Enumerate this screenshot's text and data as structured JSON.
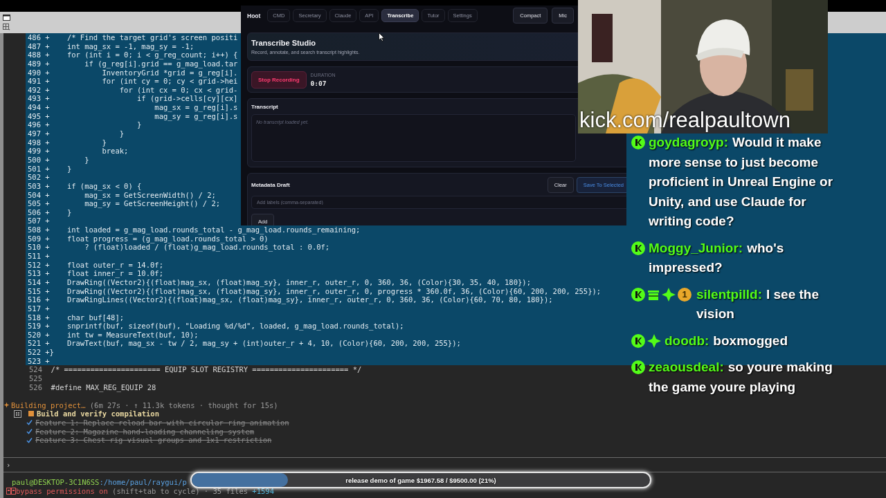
{
  "terminal": {
    "diff_lines": [
      {
        "number": "486",
        "marker": "+",
        "code": "    /* Find the target grid's screen positi"
      },
      {
        "number": "487",
        "marker": "+",
        "code": "    int mag_sx = -1, mag_sy = -1;"
      },
      {
        "number": "488",
        "marker": "+",
        "code": "    for (int i = 0; i < g_reg_count; i++) {"
      },
      {
        "number": "489",
        "marker": "+",
        "code": "        if (g_reg[i].grid == g_mag_load.tar"
      },
      {
        "number": "490",
        "marker": "+",
        "code": "            InventoryGrid *grid = g_reg[i]."
      },
      {
        "number": "491",
        "marker": "+",
        "code": "            for (int cy = 0; cy < grid->hei"
      },
      {
        "number": "492",
        "marker": "+",
        "code": "                for (int cx = 0; cx < grid-"
      },
      {
        "number": "493",
        "marker": "+",
        "code": "                    if (grid->cells[cy][cx]"
      },
      {
        "number": "494",
        "marker": "+",
        "code": "                        mag_sx = g_reg[i].s"
      },
      {
        "number": "495",
        "marker": "+",
        "code": "                        mag_sy = g_reg[i].s"
      },
      {
        "number": "496",
        "marker": "+",
        "code": "                    }"
      },
      {
        "number": "497",
        "marker": "+",
        "code": "                }"
      },
      {
        "number": "498",
        "marker": "+",
        "code": "            }"
      },
      {
        "number": "499",
        "marker": "+",
        "code": "            break;"
      },
      {
        "number": "500",
        "marker": "+",
        "code": "        }"
      },
      {
        "number": "501",
        "marker": "+",
        "code": "    }"
      },
      {
        "number": "502",
        "marker": "+"
      },
      {
        "number": "503",
        "marker": "+",
        "code": "    if (mag_sx < 0) {"
      },
      {
        "number": "504",
        "marker": "+",
        "code": "        mag_sx = GetScreenWidth() / 2;"
      },
      {
        "number": "505",
        "marker": "+",
        "code": "        mag_sy = GetScreenHeight() / 2;"
      },
      {
        "number": "506",
        "marker": "+",
        "code": "    }"
      },
      {
        "number": "507",
        "marker": "+"
      },
      {
        "number": "508",
        "marker": "+",
        "code": "    int loaded = g_mag_load.rounds_total - g_mag_load.rounds_remaining;"
      },
      {
        "number": "509",
        "marker": "+",
        "code": "    float progress = (g_mag_load.rounds_total > 0)"
      },
      {
        "number": "510",
        "marker": "+",
        "code": "        ? (float)loaded / (float)g_mag_load.rounds_total : 0.0f;"
      },
      {
        "number": "511",
        "marker": "+"
      },
      {
        "number": "512",
        "marker": "+",
        "code": "    float outer_r = 14.0f;"
      },
      {
        "number": "513",
        "marker": "+",
        "code": "    float inner_r = 10.0f;"
      },
      {
        "number": "514",
        "marker": "+",
        "code": "    DrawRing((Vector2){(float)mag_sx, (float)mag_sy}, inner_r, outer_r, 0, 360, 36, (Color){30, 35, 40, 180});"
      },
      {
        "number": "515",
        "marker": "+",
        "code": "    DrawRing((Vector2){(float)mag_sx, (float)mag_sy}, inner_r, outer_r, 0, progress * 360.0f, 36, (Color){60, 200, 200, 255});"
      },
      {
        "number": "516",
        "marker": "+",
        "code": "    DrawRingLines((Vector2){(float)mag_sx, (float)mag_sy}, inner_r, outer_r, 0, 360, 36, (Color){60, 70, 80, 180});"
      },
      {
        "number": "517",
        "marker": "+"
      },
      {
        "number": "518",
        "marker": "+",
        "code": "    char buf[48];"
      },
      {
        "number": "519",
        "marker": "+",
        "code": "    snprintf(buf, sizeof(buf), \"Loading %d/%d\", loaded, g_mag_load.rounds_total);"
      },
      {
        "number": "520",
        "marker": "+",
        "code": "    int tw = MeasureText(buf, 10);"
      },
      {
        "number": "521",
        "marker": "+",
        "code": "    DrawText(buf, mag_sx - tw / 2, mag_sy + (int)outer_r + 4, 10, (Color){60, 200, 200, 255});"
      },
      {
        "number": "522",
        "marker": "+",
        "code": "}"
      },
      {
        "number": "523",
        "marker": "+"
      }
    ],
    "context_lines": [
      {
        "number": "524",
        "code": "/* ====================== EQUIP SLOT REGISTRY ====================== */"
      },
      {
        "number": "525"
      },
      {
        "number": "526",
        "code": "#define MAX_REG_EQUIP 28"
      }
    ],
    "status": {
      "label": "Building project…",
      "detail": "(6m 27s · ↑ 11.3k tokens · thought for 15s)"
    },
    "tasks": [
      {
        "text": "Build and verify compilation",
        "done": false
      },
      {
        "text": "Feature 1: Replace reload bar with circular ring animation",
        "done": true
      },
      {
        "text": "Feature 2: Magazine hand-loading channeling system",
        "done": true
      },
      {
        "text": "Feature 3: Chest rig visual groups and 1x1 restriction",
        "done": true
      }
    ],
    "prompt": "›",
    "user_host": "paul@DESKTOP-3C1N6SS",
    "path": ":/home/paul/raygui/p",
    "mode": "bypass permissions on",
    "mode_hint": "(shift+tab to cycle) · 35 files",
    "additions": "+1594"
  },
  "app": {
    "brand": "Hoot",
    "tabs": [
      {
        "label": "CMD",
        "selected": false
      },
      {
        "label": "Secretary",
        "selected": false
      },
      {
        "label": "Claude",
        "selected": false
      },
      {
        "label": "API",
        "selected": false
      },
      {
        "label": "Transcribe",
        "selected": true
      },
      {
        "label": "Tutor",
        "selected": false
      },
      {
        "label": "Settings",
        "selected": false
      }
    ],
    "buttons": [
      "Compact",
      "Mic"
    ],
    "header": {
      "title": "Transcribe Studio",
      "subtitle": "Record, annotate, and search transcript highlights."
    },
    "recorder": {
      "button": "Stop Recording",
      "duration_label": "DURATION",
      "duration": "0:07"
    },
    "transcript": {
      "title": "Transcript",
      "placeholder": "No transcript loaded yet."
    },
    "metadata": {
      "title": "Metadata Draft",
      "clear": "Clear",
      "save": "Save To Selected",
      "placeholder": "Add labels (comma-separated)",
      "add": "Add"
    }
  },
  "webcam": {
    "kind": "picture",
    "overlay_text": "kick.com/realpaultown"
  },
  "chat": {
    "messages": [
      {
        "badges": [
          {
            "kind": "kick"
          }
        ],
        "user": "goydagroyp:",
        "text": "Would it make more sense to just become proficient in Unreal Engine or Unity, and use Claude for writing code?"
      },
      {
        "badges": [
          {
            "kind": "kick"
          }
        ],
        "user": "Moggy_Junior:",
        "text": "who's impressed?"
      },
      {
        "badges": [
          {
            "kind": "kick"
          },
          {
            "kind": "gift"
          },
          {
            "kind": "sparkle"
          },
          {
            "kind": "sub",
            "label": "1"
          }
        ],
        "user": "silentpilld:",
        "text": "I see the vision"
      },
      {
        "badges": [
          {
            "kind": "kick"
          },
          {
            "kind": "sparkle"
          }
        ],
        "user": "doodb:",
        "text": "boxmogged"
      },
      {
        "badges": [
          {
            "kind": "kick"
          }
        ],
        "user": "zeaousdeal:",
        "text": "so youre making the game youre playing"
      }
    ]
  },
  "goal": {
    "label": "release demo of game $1967.58 / $9500.00 (21%)",
    "level": 0.21
  }
}
